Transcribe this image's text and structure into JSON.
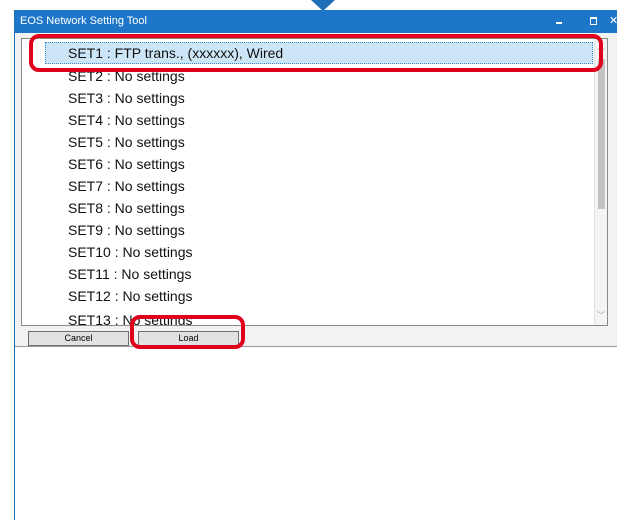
{
  "window": {
    "title": "EOS Network Setting Tool",
    "title_bar_color": "#1e76c9",
    "buttons": {
      "minimize": "minimize-icon",
      "maximize": "maximize-icon",
      "close": "close-icon"
    }
  },
  "settings_list": {
    "items": [
      {
        "label": "SET1 : FTP trans., (xxxxxx), Wired",
        "selected": true
      },
      {
        "label": "SET2 : No settings"
      },
      {
        "label": "SET3 : No settings"
      },
      {
        "label": "SET4 : No settings"
      },
      {
        "label": "SET5 : No settings"
      },
      {
        "label": "SET6 : No settings"
      },
      {
        "label": "SET7 : No settings"
      },
      {
        "label": "SET8 : No settings"
      },
      {
        "label": "SET9 : No settings"
      },
      {
        "label": "SET10 : No settings"
      },
      {
        "label": "SET11 : No settings"
      },
      {
        "label": "SET12 : No settings"
      },
      {
        "label": "SET13 : No settings"
      }
    ],
    "selection_color": "#cde6f7"
  },
  "actions": {
    "cancel_label": "Cancel",
    "load_label": "Load"
  },
  "annotations": {
    "highlight_color": "#e0001b",
    "pointer_color": "#1f6fb8"
  }
}
